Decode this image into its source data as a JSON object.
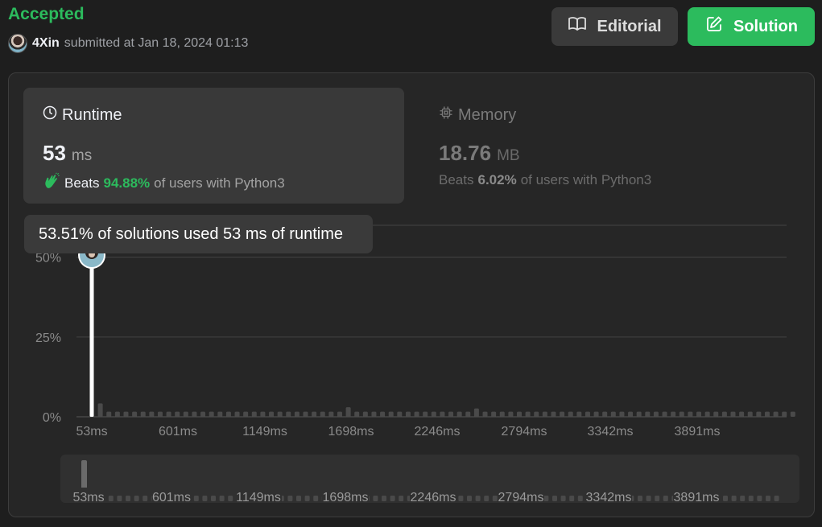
{
  "header": {
    "status": "Accepted",
    "username": "4Xin",
    "submitted_text": "submitted at Jan 18, 2024 01:13",
    "editorial_label": "Editorial",
    "solution_label": "Solution"
  },
  "runtime": {
    "title": "Runtime",
    "value": "53",
    "unit": "ms",
    "beats_label": "Beats",
    "beats_pct": "94.88%",
    "beats_suffix": "of users with Python3"
  },
  "memory": {
    "title": "Memory",
    "value": "18.76",
    "unit": "MB",
    "beats_label": "Beats",
    "beats_pct": "6.02%",
    "beats_suffix": "of users with Python3"
  },
  "tooltip": "53.51% of solutions used 53 ms of runtime",
  "colors": {
    "accent_green": "#2cbb5d",
    "selected_bar": "#ffffff",
    "other_bars": "#4a4a4a"
  },
  "chart_data": {
    "type": "bar",
    "title": "",
    "xlabel": "",
    "ylabel": "",
    "ylim": [
      0,
      60
    ],
    "yticks": [
      "0%",
      "25%",
      "50%"
    ],
    "ytick_values": [
      0,
      25,
      50
    ],
    "x_tick_labels": [
      "53ms",
      "601ms",
      "1149ms",
      "1698ms",
      "2246ms",
      "2794ms",
      "3342ms",
      "3891ms"
    ],
    "selected_bin": 0,
    "values": [
      53.51,
      4.2,
      1.6,
      1.6,
      1.6,
      1.6,
      1.6,
      1.6,
      1.6,
      1.6,
      1.6,
      1.6,
      1.6,
      1.6,
      1.6,
      1.6,
      1.6,
      1.6,
      1.6,
      1.6,
      1.6,
      1.6,
      1.6,
      1.6,
      1.6,
      1.6,
      1.6,
      1.6,
      1.6,
      1.6,
      3.0,
      1.6,
      1.6,
      1.6,
      1.6,
      1.6,
      1.6,
      1.6,
      1.6,
      1.6,
      1.6,
      1.6,
      1.6,
      1.6,
      1.6,
      2.6,
      1.6,
      1.6,
      1.6,
      1.6,
      1.6,
      1.6,
      1.6,
      1.6,
      1.6,
      1.6,
      1.6,
      1.6,
      1.6,
      1.6,
      1.6,
      1.6,
      1.6,
      1.6,
      1.6,
      1.6,
      1.6,
      1.6,
      1.6,
      1.6,
      1.6,
      1.6,
      1.6,
      1.6,
      1.6,
      1.6,
      1.6,
      1.6,
      1.6,
      1.6,
      1.6,
      1.6,
      1.6
    ]
  }
}
